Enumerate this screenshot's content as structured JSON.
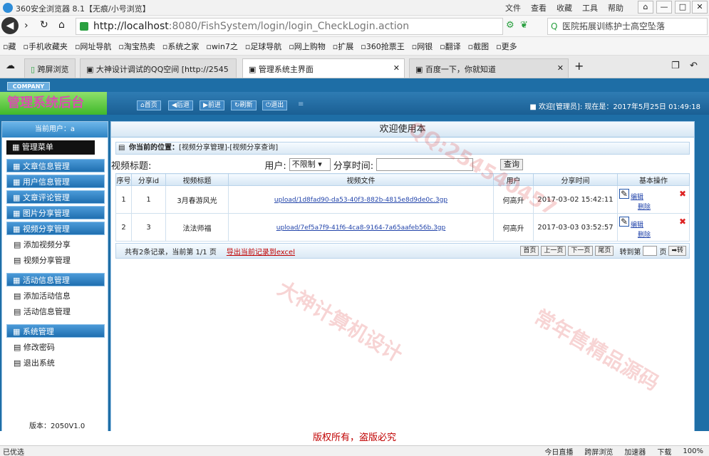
{
  "browser": {
    "title": "360安全浏览器 8.1【无痕/小号浏览】",
    "menus": [
      "文件",
      "查看",
      "收藏",
      "工具",
      "帮助"
    ],
    "url_host": "http://localhost",
    "url_rest": ":8080/FishSystem/login/login_CheckLogin.action",
    "search_text": "医院拓展训练护士高空坠落",
    "favorites": [
      "藏",
      "手机收藏夹",
      "网址导航",
      "淘宝热卖",
      "系统之家",
      "win7之",
      "足球导航",
      "网上购物",
      "扩展",
      "360抢票王",
      "网银",
      "翻译",
      "截图",
      "更多"
    ],
    "tabs": [
      "跨屏浏览",
      "大神设计调试的QQ空间 [http://2545",
      "管理系统主界面",
      "百度一下，你就知道"
    ],
    "status": {
      "left": "已优选",
      "items": [
        "今日直播",
        "跨屏浏览",
        "加速器",
        "下载",
        "100%"
      ]
    }
  },
  "app": {
    "company": "COMPANY",
    "logo": "管理系统后台",
    "nav": [
      "首页",
      "后退",
      "前进",
      "刷新",
      "退出"
    ],
    "welcome": "欢迎[管理员]: 现在是：2017年5月25日 01:49:18",
    "current_user": "当前用户：a",
    "menu_title": "管理菜单",
    "menu": [
      {
        "head": "文章信息管理"
      },
      {
        "head": "用户信息管理"
      },
      {
        "head": "文章评论管理"
      },
      {
        "head": "图片分享管理"
      },
      {
        "head": "视频分享管理",
        "items": [
          "添加视频分享",
          "视频分享管理"
        ]
      },
      {
        "head": "活动信息管理",
        "items": [
          "添加活动信息",
          "活动信息管理"
        ]
      },
      {
        "head": "系统管理",
        "items": [
          "修改密码",
          "退出系统"
        ]
      }
    ],
    "version": "版本：2050V1.0",
    "main_title": "欢迎使用本",
    "location_label": "你当前的位置：",
    "location": "[视频分享管理]-[视频分享查询]",
    "search": {
      "title_label": "视频标题:",
      "user_label": "用户:",
      "user_value": "不限制",
      "time_label": "分享时间:",
      "query": "查询"
    },
    "columns": [
      "序号",
      "分享id",
      "视频标题",
      "视频文件",
      "用户",
      "分享时间",
      "基本操作"
    ],
    "rows": [
      {
        "no": "1",
        "id": "1",
        "title": "3月春游风光",
        "file": "upload/1d8fad90-da53-40f3-882b-4815e8d9de0c.3gp",
        "user": "何高升",
        "time": "2017-03-02 15:42:11",
        "edit": "编辑",
        "del": "删除"
      },
      {
        "no": "2",
        "id": "3",
        "title": "法法师福",
        "file": "upload/7ef5a7f9-41f6-4ca8-9164-7a65aafeb56b.3gp",
        "user": "何高升",
        "time": "2017-03-03 03:52:57",
        "edit": "编辑",
        "del": "删除"
      }
    ],
    "pager": {
      "summary": "共有2条记录，当前第 1/1 页",
      "export": "导出当前记录到excel",
      "first": "首页",
      "prev": "上一页",
      "next": "下一页",
      "last": "尾页",
      "goto": "转到第",
      "page": "页",
      "go": "转"
    },
    "footer": "版权所有，盗版必究"
  },
  "watermarks": [
    "大神计算机设计",
    "QQ:254540457",
    "常年售精品源码"
  ]
}
